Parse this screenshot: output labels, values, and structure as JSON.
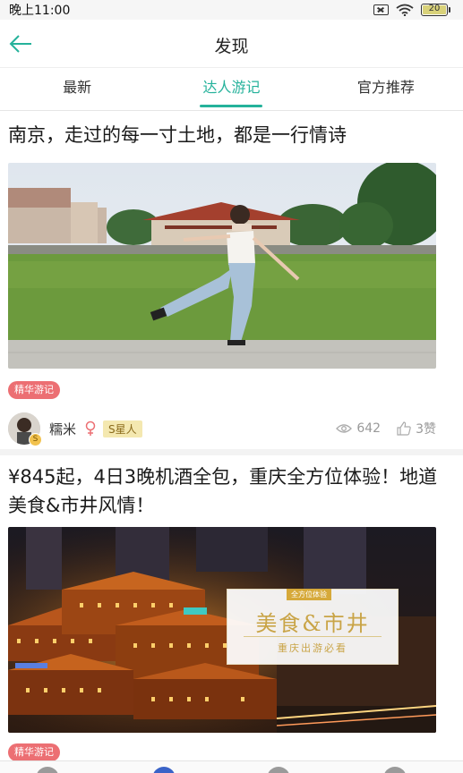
{
  "status": {
    "time": "晚上11:00",
    "battery": "20"
  },
  "header": {
    "title": "发现",
    "back_icon": "arrow-left-icon"
  },
  "tabs": [
    {
      "label": "最新",
      "active": false
    },
    {
      "label": "达人游记",
      "active": true
    },
    {
      "label": "官方推荐",
      "active": false
    }
  ],
  "posts": [
    {
      "title": "南京，走过的每一寸土地，都是一行情诗",
      "badge": "精华游记",
      "author": {
        "name": "糯米",
        "gender": "female",
        "level": "S星人",
        "avatar_badge": "S"
      },
      "views": "642",
      "likes": "3赞"
    },
    {
      "title": "¥845起，4日3晚机酒全包，重庆全方位体验！地道美食&市井风情！",
      "badge": "精华游记",
      "overlay": {
        "small": "全方位体验",
        "main": "美食&市井",
        "sub": "重庆出游必看"
      }
    }
  ],
  "colors": {
    "accent": "#25b29b",
    "badge": "#ec6f73"
  }
}
